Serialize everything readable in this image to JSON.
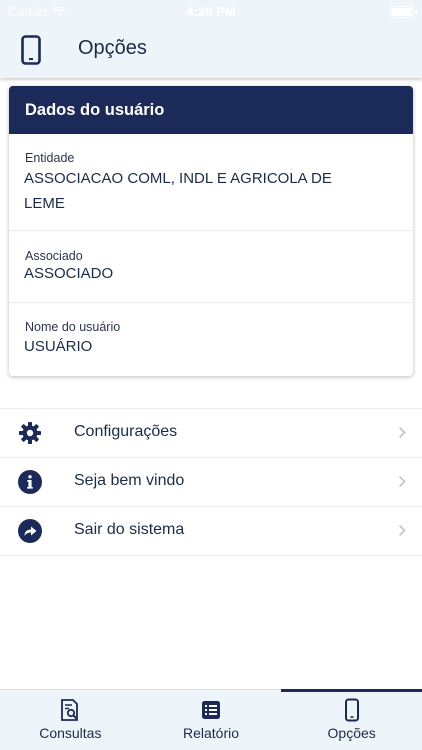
{
  "status_bar": {
    "carrier": "Carrier",
    "time": "4:28 PM"
  },
  "header": {
    "title": "Opções",
    "icon": "smartphone-icon"
  },
  "card": {
    "title": "Dados do usuário",
    "fields": [
      {
        "label": "Entidade",
        "value": "ASSOCIACAO COML, INDL E AGRICOLA DE LEME"
      },
      {
        "label": "Associado",
        "value": "ASSOCIADO"
      },
      {
        "label": "Nome do usuário",
        "value": "USUÁRIO"
      }
    ]
  },
  "menu": [
    {
      "label": "Configurações",
      "icon": "gear-icon"
    },
    {
      "label": "Seja bem vindo",
      "icon": "info-icon"
    },
    {
      "label": "Sair do sistema",
      "icon": "share-arrow-icon"
    }
  ],
  "tabs": [
    {
      "label": "Consultas",
      "icon": "document-search-icon",
      "active": false
    },
    {
      "label": "Relatório",
      "icon": "list-icon",
      "active": false
    },
    {
      "label": "Opções",
      "icon": "smartphone-icon",
      "active": true
    }
  ],
  "colors": {
    "primary": "#1b2a59",
    "header_bg": "#eef5fa",
    "text": "#1c2b4a",
    "chevron": "#c4c8ce"
  }
}
